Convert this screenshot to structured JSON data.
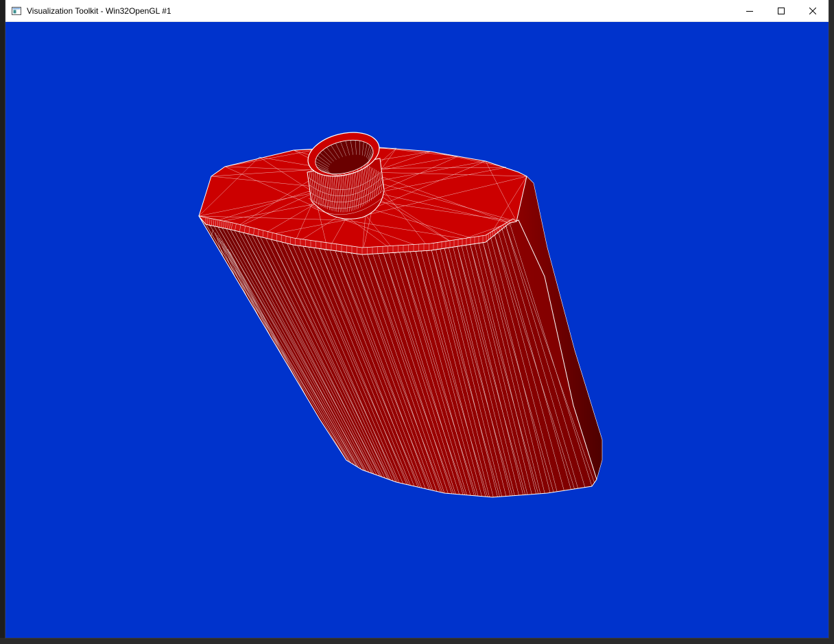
{
  "window": {
    "title": "Visualization Toolkit - Win32OpenGL #1",
    "app_icon": "vtk-window-icon",
    "controls": {
      "minimize": "minimize-icon",
      "maximize": "maximize-icon",
      "close": "close-icon"
    }
  },
  "viewport": {
    "background_color": "#0033cc",
    "model_color": "#cc0000",
    "model_shadow_color": "#7a0000",
    "wireframe_color": "#ffffff"
  }
}
